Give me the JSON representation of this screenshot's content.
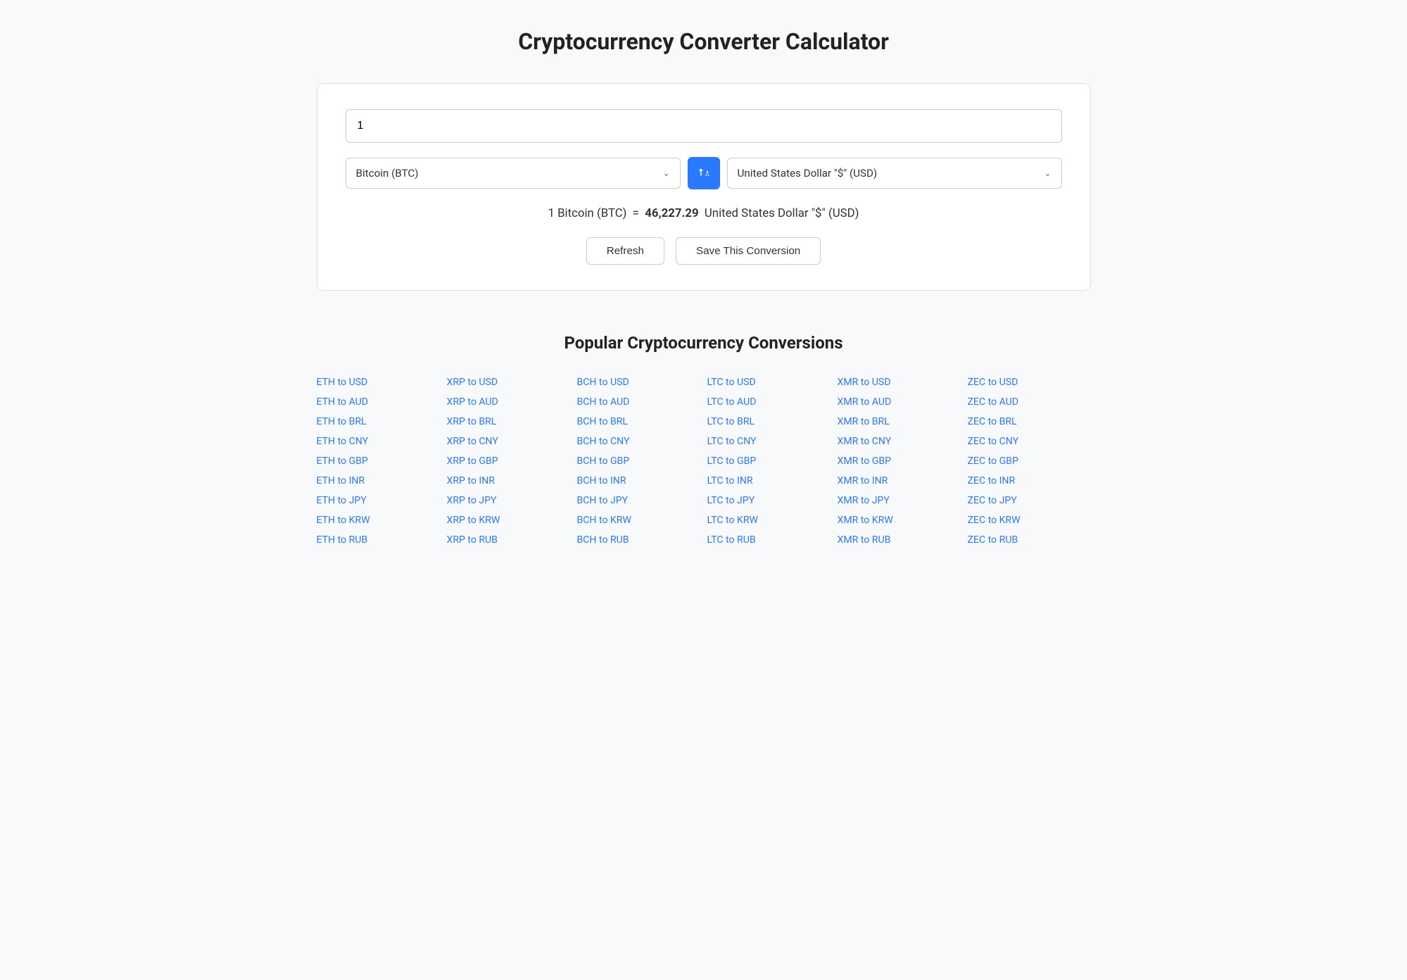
{
  "page": {
    "title": "Cryptocurrency Converter Calculator"
  },
  "converter": {
    "amount_value": "1",
    "from_currency": "Bitcoin (BTC)",
    "to_currency": "United States Dollar \"$\" (USD)",
    "result_text": "1 Bitcoin (BTC)",
    "equals": "=",
    "result_value": "46,227.29",
    "result_currency": "United States Dollar \"$\" (USD)",
    "refresh_label": "Refresh",
    "save_label": "Save This Conversion",
    "swap_icon": "⇄"
  },
  "popular": {
    "title": "Popular Cryptocurrency Conversions",
    "columns": [
      {
        "links": [
          "ETH to USD",
          "ETH to AUD",
          "ETH to BRL",
          "ETH to CNY",
          "ETH to GBP",
          "ETH to INR",
          "ETH to JPY",
          "ETH to KRW",
          "ETH to RUB"
        ]
      },
      {
        "links": [
          "XRP to USD",
          "XRP to AUD",
          "XRP to BRL",
          "XRP to CNY",
          "XRP to GBP",
          "XRP to INR",
          "XRP to JPY",
          "XRP to KRW",
          "XRP to RUB"
        ]
      },
      {
        "links": [
          "BCH to USD",
          "BCH to AUD",
          "BCH to BRL",
          "BCH to CNY",
          "BCH to GBP",
          "BCH to INR",
          "BCH to JPY",
          "BCH to KRW",
          "BCH to RUB"
        ]
      },
      {
        "links": [
          "LTC to USD",
          "LTC to AUD",
          "LTC to BRL",
          "LTC to CNY",
          "LTC to GBP",
          "LTC to INR",
          "LTC to JPY",
          "LTC to KRW",
          "LTC to RUB"
        ]
      },
      {
        "links": [
          "XMR to USD",
          "XMR to AUD",
          "XMR to BRL",
          "XMR to CNY",
          "XMR to GBP",
          "XMR to INR",
          "XMR to JPY",
          "XMR to KRW",
          "XMR to RUB"
        ]
      },
      {
        "links": [
          "ZEC to USD",
          "ZEC to AUD",
          "ZEC to BRL",
          "ZEC to CNY",
          "ZEC to GBP",
          "ZEC to INR",
          "ZEC to JPY",
          "ZEC to KRW",
          "ZEC to RUB"
        ]
      }
    ]
  }
}
